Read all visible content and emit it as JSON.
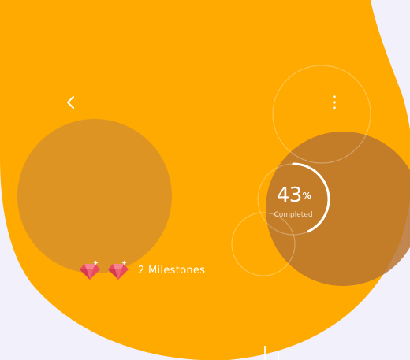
{
  "header": {
    "back_icon": "chevron-left-icon",
    "menu_icon": "more-vertical-icon"
  },
  "progress": {
    "value": "43",
    "unit": "%",
    "fraction": 0.43,
    "caption": "Completed"
  },
  "milestones": {
    "icon": "gem-icon",
    "count": 2,
    "label": "2 Milestones"
  },
  "colors": {
    "background": "#f1f0fb",
    "accent": "#ffaa00",
    "dark_circle": "#b9742f",
    "gem": "#e94b5e",
    "text": "#ffffff"
  }
}
